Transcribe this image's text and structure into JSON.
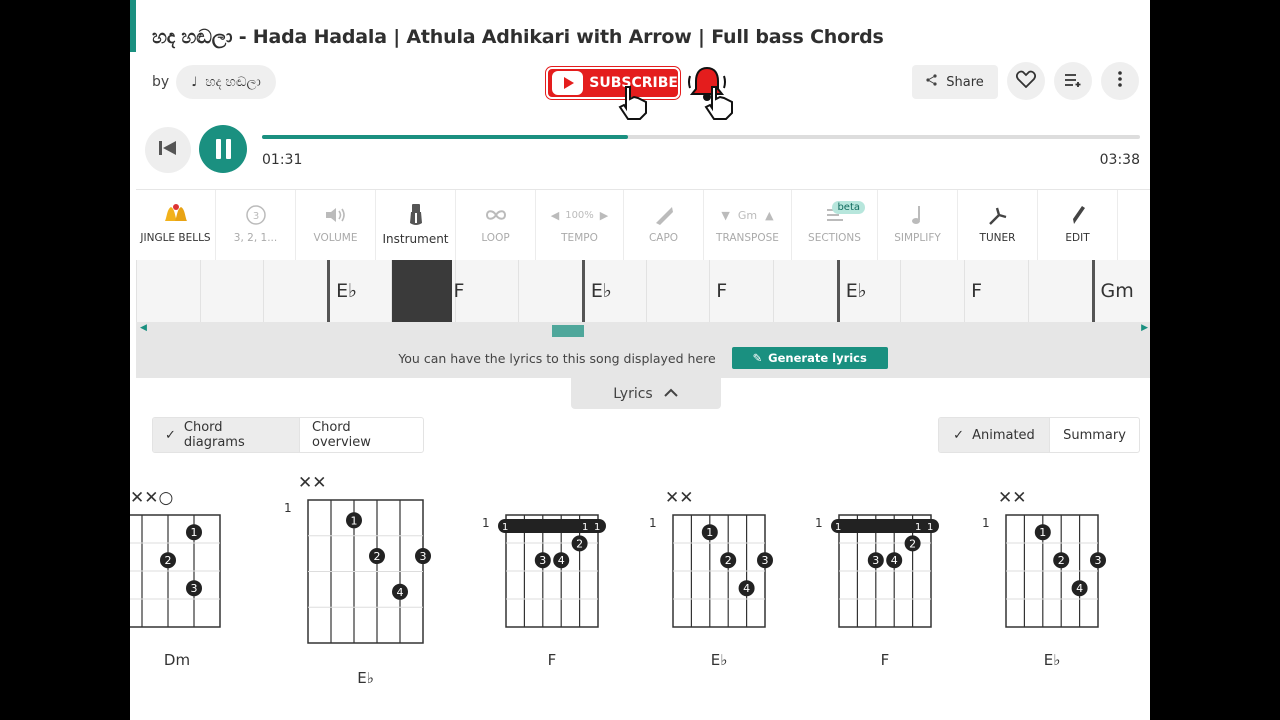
{
  "header": {
    "title": "හද හඬලා - Hada Hadala | Athula Adhikari with Arrow | Full bass Chords",
    "by_label": "by",
    "artist": "හද හඬලා",
    "subscribe_label": "SUBSCRIBE",
    "share_label": "Share"
  },
  "player": {
    "current_time": "01:31",
    "total_time": "03:38",
    "progress": 0.417
  },
  "toolbar": {
    "items": [
      {
        "label": "JINGLE BELLS",
        "icon": "bells-icon",
        "active": true
      },
      {
        "label": "3, 2, 1...",
        "icon": "countdown-icon",
        "active": false
      },
      {
        "label": "VOLUME",
        "icon": "volume-icon",
        "active": false
      },
      {
        "label": "Instrument",
        "icon": "guitar-icon",
        "active": true
      },
      {
        "label": "LOOP",
        "icon": "loop-icon",
        "active": false
      },
      {
        "label": "TEMPO",
        "icon": "tempo-icon",
        "value": "100%",
        "active": false
      },
      {
        "label": "CAPO",
        "icon": "capo-icon",
        "active": false
      },
      {
        "label": "TRANSPOSE",
        "icon": "transpose-icon",
        "value": "Gm",
        "active": false
      },
      {
        "label": "SECTIONS",
        "icon": "sections-icon",
        "badge": "beta",
        "active": false
      },
      {
        "label": "SIMPLIFY",
        "icon": "note-icon",
        "active": false
      },
      {
        "label": "TUNER",
        "icon": "tuner-icon",
        "active": true
      },
      {
        "label": "EDIT",
        "icon": "pencil-icon",
        "active": true
      }
    ]
  },
  "chord_strip": {
    "chords": [
      "E♭",
      "F",
      "E♭",
      "F",
      "E♭",
      "F",
      "Gm"
    ]
  },
  "lyrics_bar": {
    "text": "You can have the lyrics to this song displayed here",
    "button": "Generate lyrics",
    "tab": "Lyrics"
  },
  "view_toggle": {
    "left": [
      "Chord diagrams",
      "Chord overview"
    ],
    "right": [
      "Animated",
      "Summary"
    ]
  },
  "chord_diagrams": [
    {
      "name": "Dm"
    },
    {
      "name": "E♭",
      "fret": "1"
    },
    {
      "name": "F",
      "fret": "1"
    },
    {
      "name": "E♭",
      "fret": "1"
    },
    {
      "name": "F",
      "fret": "1"
    },
    {
      "name": "E♭",
      "fret": "1"
    }
  ],
  "colors": {
    "accent": "#1a9080",
    "subscribe": "#e41d1d"
  }
}
